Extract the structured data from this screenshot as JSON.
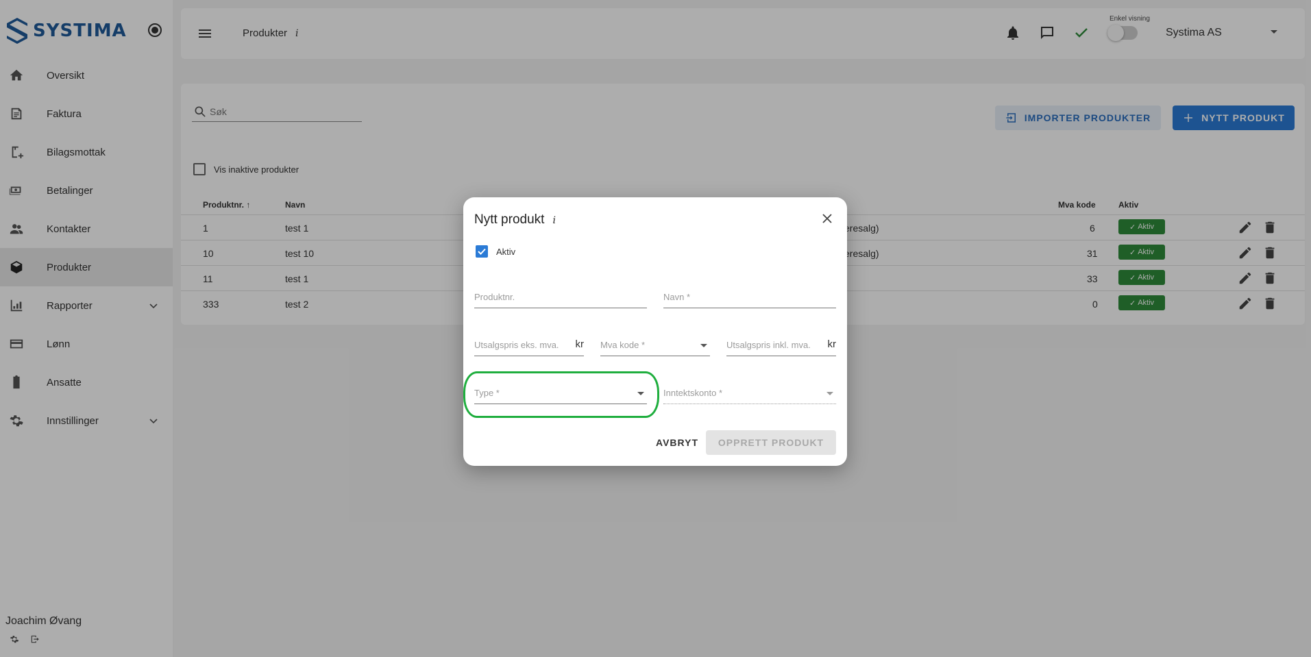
{
  "brand": {
    "name": "SYSTIMA",
    "color": "#1f5a9a"
  },
  "sidebar": {
    "items": [
      {
        "label": "Oversikt",
        "icon": "home-icon"
      },
      {
        "label": "Faktura",
        "icon": "invoice-icon"
      },
      {
        "label": "Bilagsmottak",
        "icon": "receipt-add-icon"
      },
      {
        "label": "Betalinger",
        "icon": "payments-icon"
      },
      {
        "label": "Kontakter",
        "icon": "people-icon"
      },
      {
        "label": "Produkter",
        "icon": "product-box-icon",
        "active": true
      },
      {
        "label": "Rapporter",
        "icon": "reports-icon",
        "expandable": true
      },
      {
        "label": "Lønn",
        "icon": "credit-card-icon"
      },
      {
        "label": "Ansatte",
        "icon": "clipboard-icon"
      },
      {
        "label": "Innstillinger",
        "icon": "gear-icon",
        "expandable": true
      }
    ],
    "user_name": "Joachim Øvang"
  },
  "topbar": {
    "breadcrumb": "Produkter",
    "info": "i",
    "toggle_label": "Enkel visning",
    "company": "Systima AS"
  },
  "toolbar": {
    "search_placeholder": "Søk",
    "import_label": "IMPORTER PRODUKTER",
    "new_label": "NYTT PRODUKT",
    "inactive_label": "Vis inaktive produkter"
  },
  "table": {
    "headers": {
      "nr": "Produktnr.",
      "name": "Navn",
      "mva": "Mva kode",
      "active": "Aktiv"
    },
    "rows": [
      {
        "nr": "1",
        "name": "test 1",
        "extra": "eresalg)",
        "mva": "6",
        "status": "Aktiv"
      },
      {
        "nr": "10",
        "name": "test 10",
        "extra": "eresalg)",
        "mva": "31",
        "status": "Aktiv"
      },
      {
        "nr": "11",
        "name": "test 1",
        "extra": "",
        "mva": "33",
        "status": "Aktiv"
      },
      {
        "nr": "333",
        "name": "test 2",
        "extra": "",
        "mva": "0",
        "status": "Aktiv"
      }
    ]
  },
  "dialog": {
    "title": "Nytt produkt",
    "info": "i",
    "active_label": "Aktiv",
    "fields": {
      "produktnr": "Produktnr.",
      "navn": "Navn *",
      "pris_eks": "Utsalgspris eks. mva.",
      "pris_eks_suffix": "kr",
      "mva_kode": "Mva kode *",
      "pris_inkl": "Utsalgspris inkl. mva.",
      "pris_inkl_suffix": "kr",
      "type": "Type *",
      "inntektskonto": "Inntektskonto *"
    },
    "cancel_label": "AVBRYT",
    "create_label": "OPPRETT PRODUKT"
  },
  "colors": {
    "accent": "#2b7bd6",
    "success": "#2e8b3a",
    "highlight": "#1fae3e"
  }
}
